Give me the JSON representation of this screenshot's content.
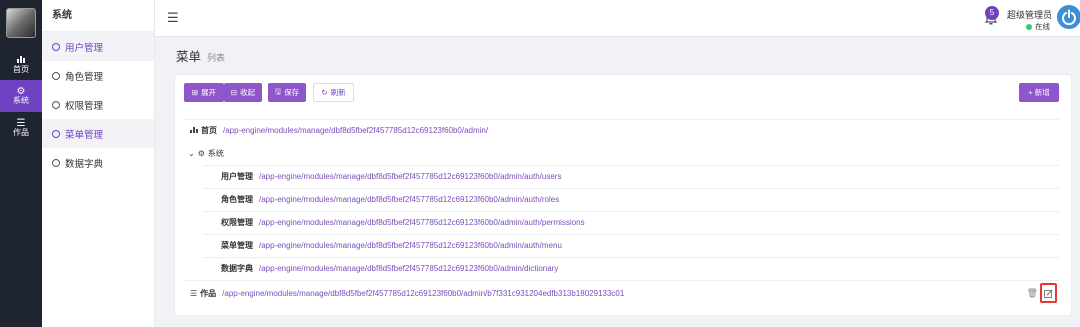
{
  "rail": {
    "items": [
      {
        "label": "首页",
        "icon": "bar-chart-icon"
      },
      {
        "label": "系统",
        "icon": "gear-icon"
      },
      {
        "label": "作品",
        "icon": "list-icon"
      }
    ]
  },
  "submenu": {
    "title": "系统",
    "items": [
      {
        "label": "用户管理"
      },
      {
        "label": "角色管理"
      },
      {
        "label": "权限管理"
      },
      {
        "label": "菜单管理"
      },
      {
        "label": "数据字典"
      }
    ]
  },
  "topbar": {
    "badge_count": "5",
    "user_name": "超级管理员",
    "user_status": "在线"
  },
  "page": {
    "title": "菜单",
    "subtitle": "列表"
  },
  "toolbar": {
    "expand_label": "展开",
    "collapse_label": "收起",
    "save_label": "保存",
    "refresh_label": "刷新",
    "new_label": "+ 新增"
  },
  "tree": {
    "home": {
      "label": "首页",
      "path": "/app-engine/modules/manage/dbf8d5fbef2f457785d12c69123f60b0/admin/"
    },
    "system": {
      "label": "系统",
      "children": [
        {
          "label": "用户管理",
          "path": "/app-engine/modules/manage/dbf8d5fbef2f457785d12c69123f60b0/admin/auth/users"
        },
        {
          "label": "角色管理",
          "path": "/app-engine/modules/manage/dbf8d5fbef2f457785d12c69123f60b0/admin/auth/roles"
        },
        {
          "label": "权限管理",
          "path": "/app-engine/modules/manage/dbf8d5fbef2f457785d12c69123f60b0/admin/auth/permissions"
        },
        {
          "label": "菜单管理",
          "path": "/app-engine/modules/manage/dbf8d5fbef2f457785d12c69123f60b0/admin/auth/menu"
        },
        {
          "label": "数据字典",
          "path": "/app-engine/modules/manage/dbf8d5fbef2f457785d12c69123f60b0/admin/dictionary"
        }
      ]
    },
    "works": {
      "label": "作品",
      "path": "/app-engine/modules/manage/dbf8d5fbef2f457785d12c69123f60b0/admin/b7f331c931204edfb313b18029133c01"
    }
  },
  "colors": {
    "accent": "#6f42c1",
    "sidebar_bg": "#1e2430",
    "highlight_border": "#e53935",
    "online": "#2ecc71"
  }
}
